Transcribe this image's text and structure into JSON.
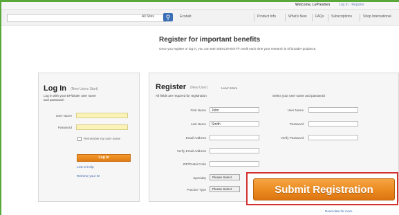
{
  "topbar": {
    "welcome": "Welcome, LePreshen",
    "account_links": "Log In · Register"
  },
  "searchbar": {
    "placeholder": "",
    "scope": "All Sites",
    "nav_links": [
      "Ecobalt",
      "Product Info",
      "What's New",
      "FAQs",
      "Subscriptions",
      "Shop International"
    ]
  },
  "main": {
    "headline": "Register for important benefits",
    "intro": "Once you register or log in, you can earn EBSCOHOST® credit each time your research is of broader guidance."
  },
  "login": {
    "title": "Log In",
    "title_note": "(New Users Start)",
    "intro": "Log in with your EP/Dialer user name and password:",
    "fields": [
      {
        "label": "User Name",
        "value": ""
      },
      {
        "label": "Password",
        "value": ""
      }
    ],
    "remember_label": "Remember my user name",
    "login_button": "Log In",
    "links": [
      "Lost Id Help",
      "Retrieve your ID"
    ]
  },
  "register": {
    "title": "Register",
    "title_note": "(New User)",
    "learn_more": "Learn More",
    "required_note": "All fields are required for registration",
    "right_note": "Select your user name and password",
    "left_fields": [
      {
        "label": "First Name",
        "value": "John"
      },
      {
        "label": "Last Name",
        "value": "Smith"
      },
      {
        "label": "Email Address",
        "value": ""
      },
      {
        "label": "Verify Email Address",
        "value": ""
      },
      {
        "label": "ZIP/Postal Code",
        "value": ""
      }
    ],
    "right_fields": [
      {
        "label": "User Name",
        "value": ""
      },
      {
        "label": "Password",
        "value": ""
      },
      {
        "label": "Verify Password",
        "value": ""
      }
    ],
    "selects": [
      {
        "label": "Specialty",
        "value": "Please Select"
      },
      {
        "label": "Practice Type",
        "value": "Please Select"
      }
    ],
    "submit_button": "Submit Registration",
    "bottom_link": "Read data for more"
  },
  "colors": {
    "frame": "#5aa83a",
    "submit": "#ea8a1f",
    "highlight": "#d2312f",
    "link": "#3b63b0"
  }
}
